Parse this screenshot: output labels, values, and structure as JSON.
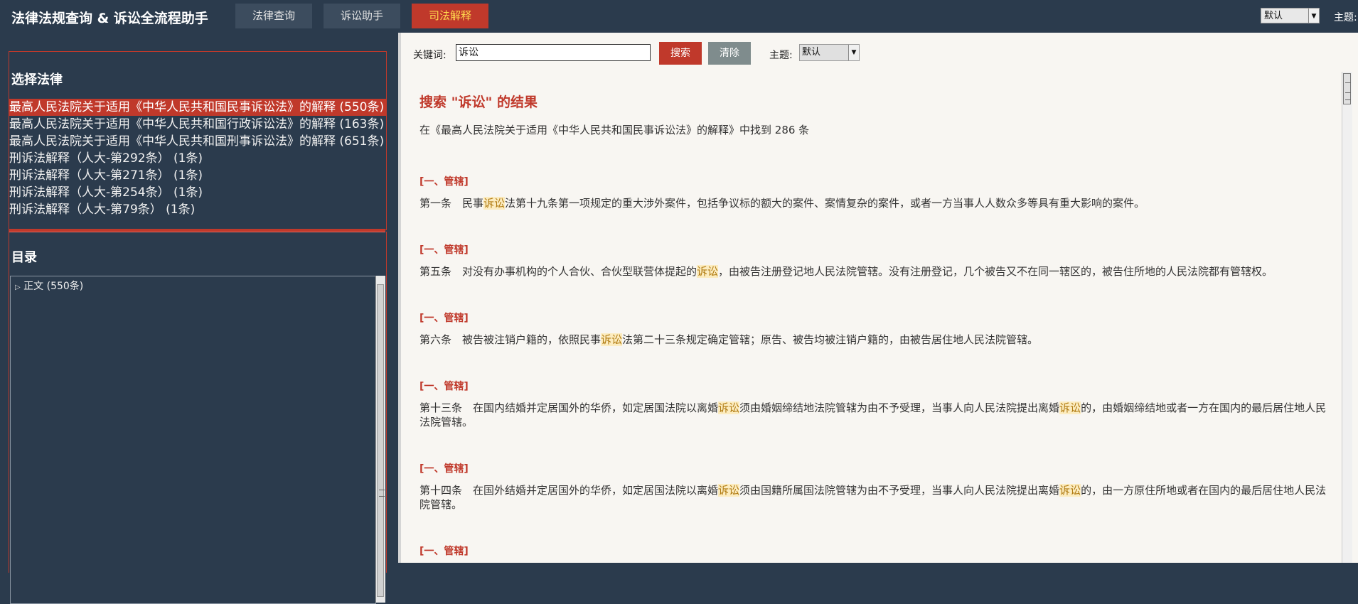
{
  "app": {
    "title": "法律法规查询 & 诉讼全流程助手"
  },
  "nav": {
    "tabs": [
      {
        "label": "法律查询",
        "active": false
      },
      {
        "label": "诉讼助手",
        "active": false
      },
      {
        "label": "司法解释",
        "active": true
      }
    ],
    "theme_select_value": "默认",
    "theme_label": "主题:"
  },
  "sidebar": {
    "laws_title": "选择法律",
    "laws": [
      {
        "label": "最高人民法院关于适用《中华人民共和国民事诉讼法》的解释 (550条)",
        "selected": true
      },
      {
        "label": "最高人民法院关于适用《中华人民共和国行政诉讼法》的解释 (163条)",
        "selected": false
      },
      {
        "label": "最高人民法院关于适用《中华人民共和国刑事诉讼法》的解释 (651条)",
        "selected": false
      },
      {
        "label": "刑诉法解释（人大-第292条） (1条)",
        "selected": false
      },
      {
        "label": "刑诉法解释（人大-第271条） (1条)",
        "selected": false
      },
      {
        "label": "刑诉法解释（人大-第254条） (1条)",
        "selected": false
      },
      {
        "label": "刑诉法解释（人大-第79条） (1条)",
        "selected": false
      }
    ],
    "toc_title": "目录",
    "toc_nodes": [
      {
        "label": "正文 (550条)",
        "expanded": false
      }
    ]
  },
  "search": {
    "keyword_label": "关键词:",
    "keyword_value": "诉讼",
    "search_button": "搜索",
    "clear_button": "清除",
    "theme_label": "主题:",
    "theme_value": "默认"
  },
  "results": {
    "title": "搜索 \"诉讼\" 的结果",
    "summary": "在《最高人民法院关于适用《中华人民共和国民事诉讼法》的解释》中找到 286 条",
    "highlight_term": "诉讼",
    "entries": [
      {
        "category": "[一、管辖]",
        "text": "第一条　民事诉讼法第十九条第一项规定的重大涉外案件，包括争议标的额大的案件、案情复杂的案件，或者一方当事人人数众多等具有重大影响的案件。"
      },
      {
        "category": "[一、管辖]",
        "text": "第五条　对没有办事机构的个人合伙、合伙型联营体提起的诉讼，由被告注册登记地人民法院管辖。没有注册登记，几个被告又不在同一辖区的，被告住所地的人民法院都有管辖权。"
      },
      {
        "category": "[一、管辖]",
        "text": "第六条　被告被注销户籍的，依照民事诉讼法第二十三条规定确定管辖；原告、被告均被注销户籍的，由被告居住地人民法院管辖。"
      },
      {
        "category": "[一、管辖]",
        "text": "第十三条　在国内结婚并定居国外的华侨，如定居国法院以离婚诉讼须由婚姻缔结地法院管辖为由不予受理，当事人向人民法院提出离婚诉讼的，由婚姻缔结地或者一方在国内的最后居住地人民法院管辖。"
      },
      {
        "category": "[一、管辖]",
        "text": "第十四条　在国外结婚并定居国外的华侨，如定居国法院以离婚诉讼须由国籍所属国法院管辖为由不予受理，当事人向人民法院提出离婚诉讼的，由一方原住所地或者在国内的最后居住地人民法院管辖。"
      },
      {
        "category": "[一、管辖]",
        "text": ""
      }
    ]
  },
  "colors": {
    "accent": "#c0392b",
    "panel_bg": "#2b3b4d",
    "content_bg": "#f8f6f2",
    "highlight_bg": "#fcecc0",
    "active_tab_text": "#ffd84d"
  }
}
